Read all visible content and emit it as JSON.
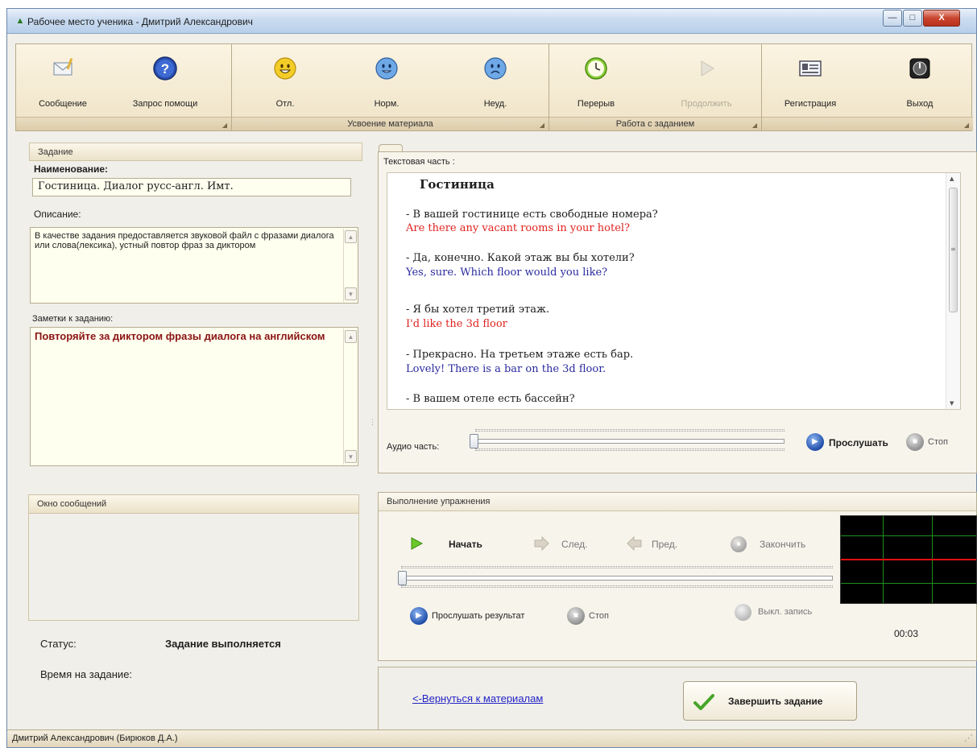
{
  "window": {
    "title": "Рабочее место ученика - Дмитрий Александрович",
    "minimize": "—",
    "maximize": "□",
    "close": "X"
  },
  "ribbon": {
    "groups": [
      {
        "footer": ""
      },
      {
        "footer": "Усвоение материала"
      },
      {
        "footer": "Работа с заданием"
      },
      {
        "footer": ""
      }
    ],
    "buttons": {
      "message": "Сообщение",
      "help": "Запрос помощи",
      "excellent": "Отл.",
      "normal": "Норм.",
      "poor": "Неуд.",
      "break": "Перерыв",
      "continue": "Продолжить",
      "register": "Регистрация",
      "exit": "Выход"
    }
  },
  "task": {
    "header": "Задание",
    "name_label": "Наименование:",
    "name_value": "Гостиница. Диалог русс-англ. Имт.",
    "desc_label": "Описание:",
    "desc_value": "В качестве задания предоставляется звуковой файл с фразами диалога или слова(лексика), устный повтор фраз за диктором",
    "notes_label": "Заметки к заданию:",
    "notes_value": "Повторяйте за диктором фразы диалога на английском"
  },
  "messages": {
    "header": "Окно сообщений"
  },
  "status": {
    "label": "Статус:",
    "value": "Задание выполняется",
    "time_label": "Время на задание:"
  },
  "text_part": {
    "label": "Текстовая часть :",
    "title": "Гостиница",
    "lines": [
      {
        "ru": "- В вашей гостинице есть свободные номера?",
        "en": "Are there any vacant rooms in your hotel?",
        "color": "#e0231f"
      },
      {
        "ru": "- Да, конечно. Какой этаж вы бы хотели?",
        "en": "Yes, sure. Which floor would you like?",
        "color": "#2a2aa0"
      },
      {
        "ru": "- Я бы хотел третий этаж.",
        "en": "I'd like the 3d floor",
        "color": "#e0231f"
      },
      {
        "ru": "- Прекрасно. На третьем этаже есть бар.",
        "en": "Lovely! There is a bar on the 3d floor.",
        "color": "#2a2aa0"
      },
      {
        "ru": "- В вашем отеле есть бассейн?",
        "en": "",
        "color": "#e0231f"
      }
    ]
  },
  "audio": {
    "label": "Аудио часть:",
    "listen": "Прослушать",
    "stop": "Стоп",
    "position": 0
  },
  "exercise": {
    "header": "Выполнение упражнения",
    "start": "Начать",
    "next": "След.",
    "prev": "Пред.",
    "finish": "Закончить",
    "listen_result": "Прослушать результат",
    "stop": "Стоп",
    "record_toggle": "Выкл. запись",
    "timer": "00:03",
    "position": 0
  },
  "footer": {
    "back_link": "<-Вернуться к материалам",
    "complete_button": "Завершить задание"
  },
  "statusbar": {
    "user": "Дмитрий Александрович (Бирюков Д.А.)"
  },
  "colors": {
    "ribbon_bg": "#f3e9d0",
    "notes_text": "#8b1414",
    "link": "#2424c8",
    "scope_grid": "#1f8f1f",
    "scope_line": "#e01010"
  },
  "icons": {
    "title": "app-icon",
    "message": "envelope-icon",
    "help": "question-icon",
    "excellent": "smiley-happy-icon",
    "normal": "smiley-neutral-icon",
    "poor": "smiley-sad-icon",
    "break": "clock-icon",
    "continue": "play-icon",
    "register": "id-card-icon",
    "exit": "power-icon"
  }
}
